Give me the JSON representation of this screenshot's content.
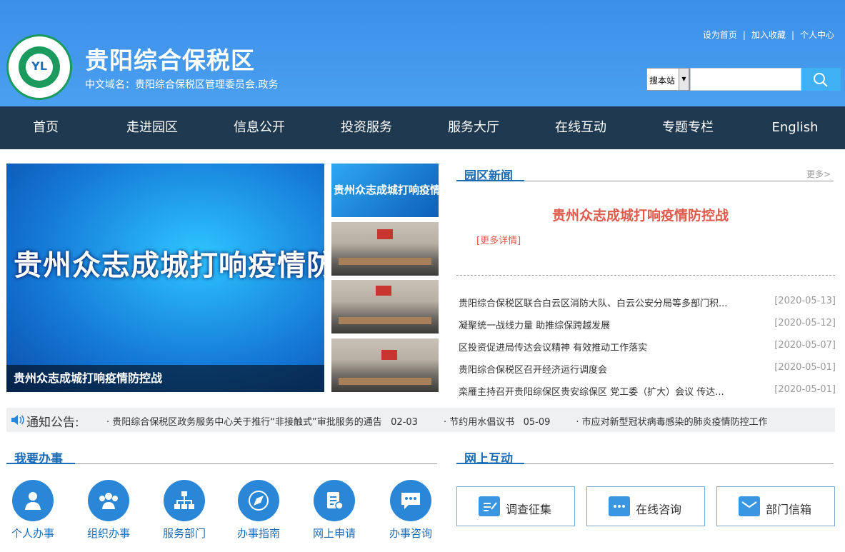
{
  "header": {
    "title": "贵阳综合保税区",
    "subtitle": "中文域名：贵阳综合保税区管理委员会.政务",
    "links": [
      "设为首页",
      "加入收藏",
      "个人中心"
    ],
    "search_scope": "搜本站",
    "logo_text": "YL"
  },
  "nav": [
    "首页",
    "走进园区",
    "信息公开",
    "投资服务",
    "服务大厅",
    "在线互动",
    "专题专栏",
    "English"
  ],
  "slider": {
    "banner_text": "贵州众志成城打响疫情防控战",
    "caption": "贵州众志成城打响疫情防控战",
    "thumb1_text": "贵州众志成城打响疫情防控战"
  },
  "news": {
    "title": "园区新闻",
    "more": "更多>",
    "headline": "贵州众志成城打响疫情防控战",
    "detail": "[更多详情]",
    "items": [
      {
        "title": "贵阳综合保税区联合白云区消防大队、白云公安分局等多部门积...",
        "date": "[2020-05-13]"
      },
      {
        "title": "凝聚统一战线力量 助推综保跨越发展",
        "date": "[2020-05-12]"
      },
      {
        "title": "区投资促进局传达会议精神 有效推动工作落实",
        "date": "[2020-05-07]"
      },
      {
        "title": "贵阳综合保税区召开经济运行调度会",
        "date": "[2020-05-01]"
      },
      {
        "title": "栾雁主持召开贵阳综保区贵安综保区 党工委（扩大）会议 传达...",
        "date": "[2020-05-01]"
      }
    ]
  },
  "notice": {
    "label": "通知公告:",
    "items": [
      {
        "title": "贵阳综合保税区政务服务中心关于推行“非接触式”审批服务的通告",
        "date": "02-03"
      },
      {
        "title": "节约用水倡议书",
        "date": "05-09"
      },
      {
        "title": "市应对新型冠状病毒感染的肺炎疫情防控工作",
        "date": ""
      }
    ]
  },
  "services": {
    "title": "我要办事",
    "items": [
      "个人办事",
      "组织办事",
      "服务部门",
      "办事指南",
      "网上申请",
      "办事咨询"
    ]
  },
  "interaction": {
    "title": "网上互动",
    "items": [
      "调查征集",
      "在线咨询",
      "部门信箱"
    ]
  }
}
